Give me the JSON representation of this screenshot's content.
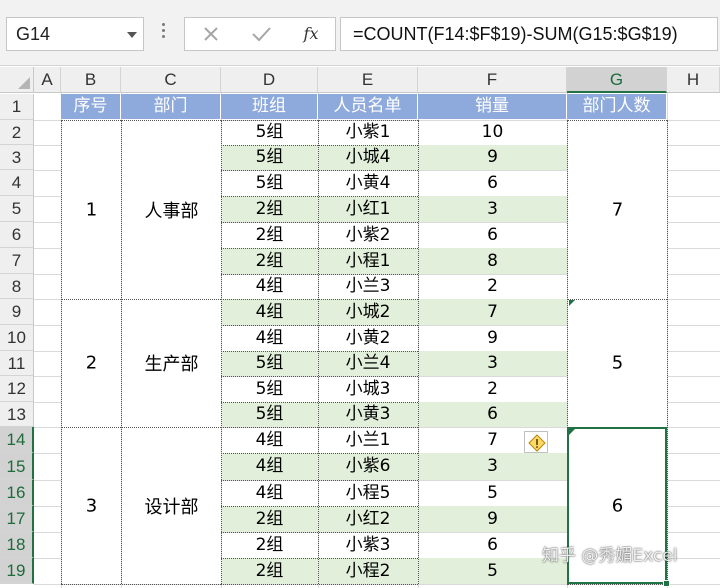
{
  "formula_bar": {
    "name_box": "G14",
    "cancel_icon": "cancel-icon",
    "enter_icon": "check-icon",
    "fx_label": "fx",
    "formula": "=COUNT(F14:$F$19)-SUM(G15:$G$19)"
  },
  "sheet": {
    "columns": [
      "A",
      "B",
      "C",
      "D",
      "E",
      "F",
      "G",
      "H"
    ],
    "selected_column": "G",
    "rows": [
      "1",
      "2",
      "3",
      "4",
      "5",
      "6",
      "7",
      "8",
      "9",
      "10",
      "11",
      "12",
      "13",
      "14",
      "15",
      "16",
      "17",
      "18",
      "19"
    ],
    "selected_rows": [
      "14",
      "15",
      "16",
      "17",
      "18",
      "19"
    ],
    "headers": [
      "序号",
      "部门",
      "班组",
      "人员名单",
      "销量",
      "部门人数"
    ],
    "data_rows": [
      {
        "group": "5组",
        "name": "小紫1",
        "sales": "10"
      },
      {
        "group": "5组",
        "name": "小城4",
        "sales": "9"
      },
      {
        "group": "5组",
        "name": "小黄4",
        "sales": "6"
      },
      {
        "group": "2组",
        "name": "小红1",
        "sales": "3"
      },
      {
        "group": "2组",
        "name": "小紫2",
        "sales": "6"
      },
      {
        "group": "2组",
        "name": "小程1",
        "sales": "8"
      },
      {
        "group": "4组",
        "name": "小兰3",
        "sales": "2"
      },
      {
        "group": "4组",
        "name": "小城2",
        "sales": "7"
      },
      {
        "group": "4组",
        "name": "小黄2",
        "sales": "9"
      },
      {
        "group": "5组",
        "name": "小兰4",
        "sales": "3"
      },
      {
        "group": "5组",
        "name": "小城3",
        "sales": "2"
      },
      {
        "group": "5组",
        "name": "小黄3",
        "sales": "6"
      },
      {
        "group": "4组",
        "name": "小兰1",
        "sales": "7"
      },
      {
        "group": "4组",
        "name": "小紫6",
        "sales": "3"
      },
      {
        "group": "4组",
        "name": "小程5",
        "sales": "5"
      },
      {
        "group": "2组",
        "name": "小红2",
        "sales": "9"
      },
      {
        "group": "2组",
        "name": "小紫3",
        "sales": "6"
      },
      {
        "group": "2组",
        "name": "小程2",
        "sales": "5"
      }
    ],
    "departments": [
      {
        "index": "1",
        "name": "人事部",
        "count": "7"
      },
      {
        "index": "2",
        "name": "生产部",
        "count": "5"
      },
      {
        "index": "3",
        "name": "设计部",
        "count": "6"
      }
    ],
    "error_indicator_icon": "warning-diamond-icon"
  },
  "watermark": "知乎 @秀媚Excel",
  "colors": {
    "header_fill": "#8ea9db",
    "band_fill": "#e2efda",
    "selection": "#217346"
  }
}
